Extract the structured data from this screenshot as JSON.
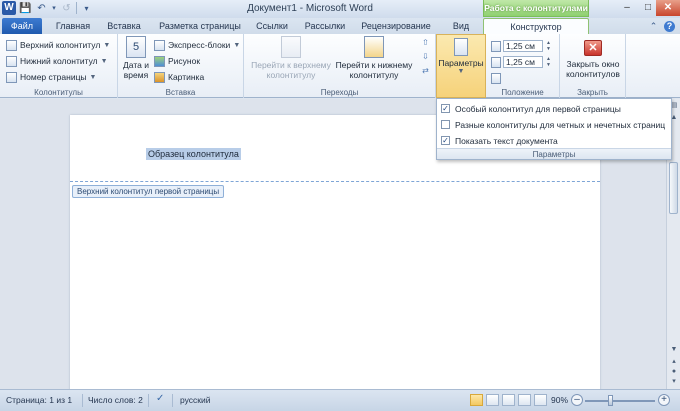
{
  "window": {
    "title": "Документ1 - Microsoft Word",
    "context_tab_group": "Работа с колонтитулами",
    "app_icon": "W"
  },
  "tabs": [
    "Файл",
    "Главная",
    "Вставка",
    "Разметка страницы",
    "Ссылки",
    "Рассылки",
    "Рецензирование",
    "Вид",
    "Конструктор"
  ],
  "ribbon": {
    "hf_group": {
      "items": [
        "Верхний колонтитул",
        "Нижний колонтитул",
        "Номер страницы"
      ],
      "label": "Колонтитулы"
    },
    "insert_group": {
      "date_time_label_1": "Дата и",
      "date_time_label_2": "время",
      "express_blocks": "Экспресс-блоки",
      "picture": "Рисунок",
      "clip": "Картинка",
      "label": "Вставка"
    },
    "nav_group": {
      "to_header_1": "Перейти к верхнему",
      "to_header_2": "колонтитулу",
      "to_footer_1": "Перейти к нижнему",
      "to_footer_2": "колонтитулу",
      "label": "Переходы"
    },
    "params": {
      "label": "Параметры"
    },
    "position_group": {
      "header_offset": "1,25 см",
      "footer_offset": "1,25 см",
      "label": "Положение"
    },
    "close_group": {
      "close_1": "Закрыть окно",
      "close_2": "колонтитулов",
      "label": "Закрыть"
    }
  },
  "params_panel": {
    "options": [
      {
        "label": "Особый колонтитул для первой страницы",
        "checked": true
      },
      {
        "label": "Разные колонтитулы для четных и нечетных страниц",
        "checked": false
      },
      {
        "label": "Показать текст документа",
        "checked": true
      }
    ],
    "label": "Параметры"
  },
  "document": {
    "header_sample_text": "Образец колонтитула",
    "header_tag": "Верхний колонтитул первой страницы"
  },
  "statusbar": {
    "page": "Страница: 1 из 1",
    "words": "Число слов: 2",
    "language": "русский",
    "zoom": "90%",
    "zoom_value_percent": 90
  },
  "colors": {
    "accent_file_tab": "#1f5aaf",
    "context_green": "#8fd070",
    "close_red": "#c8332c",
    "highlight_yellow": "#f6d27a"
  }
}
